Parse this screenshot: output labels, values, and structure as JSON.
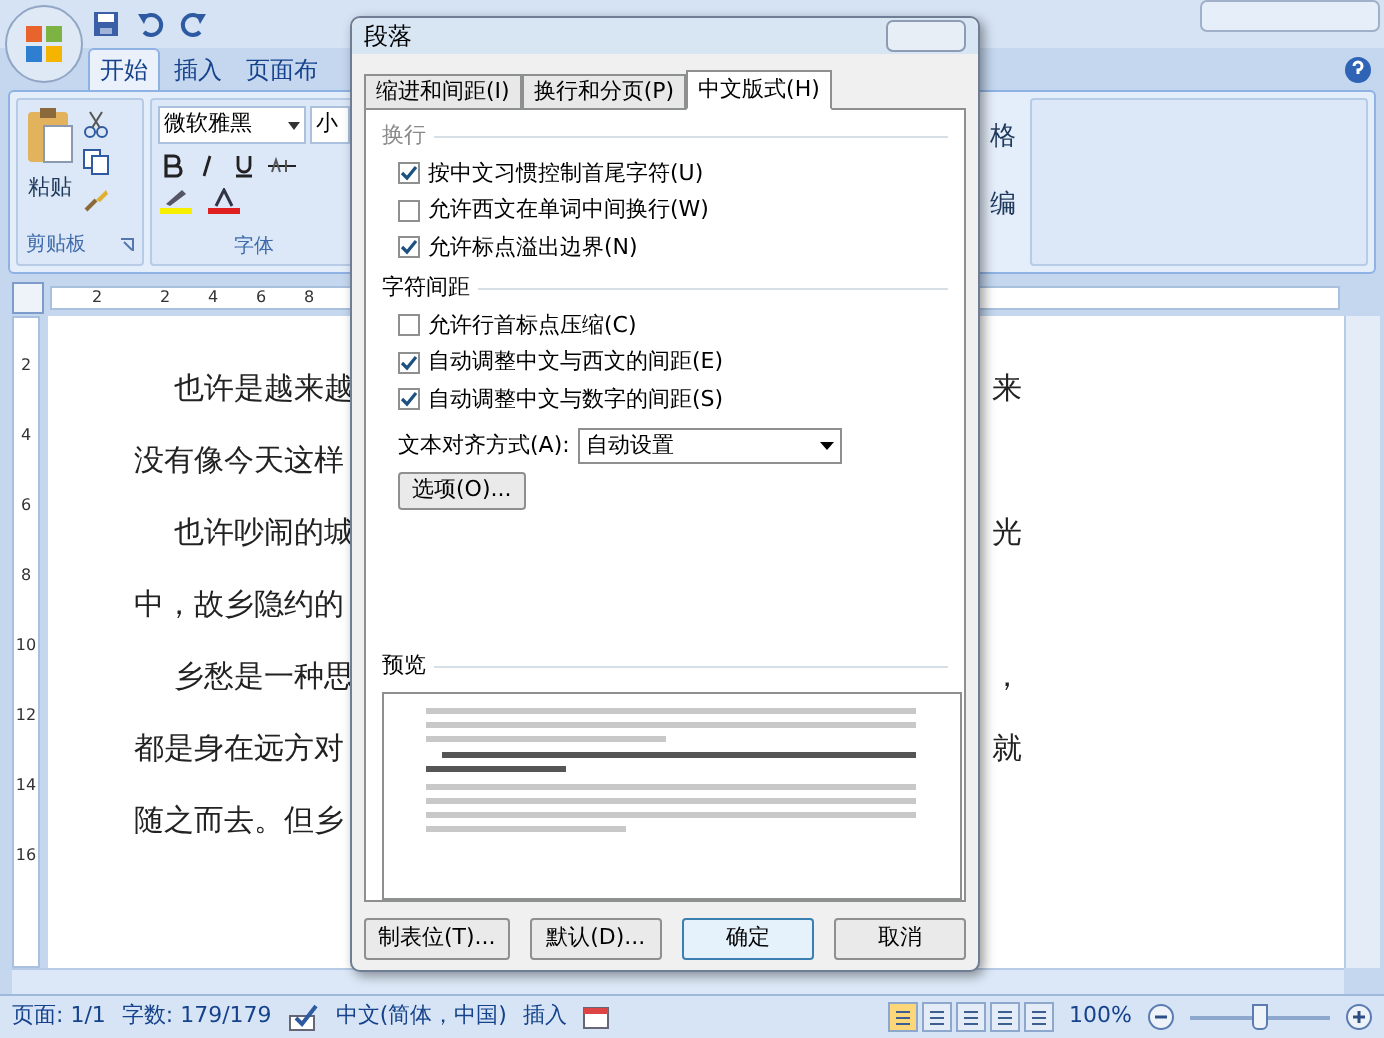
{
  "ribbon": {
    "tabs": [
      {
        "label": "开始",
        "selected": true
      },
      {
        "label": "插入",
        "selected": false
      },
      {
        "label": "页面布",
        "selected": false
      }
    ],
    "clipboard": {
      "paste": "粘贴",
      "group_label": "剪贴板"
    },
    "font": {
      "name": "微软雅黑",
      "size": "小",
      "group_label": "字体"
    },
    "fragments": [
      "格",
      "编"
    ]
  },
  "ruler": {
    "horizontal": [
      "2",
      "2",
      "4",
      "6",
      "8"
    ],
    "vertical": [
      "2",
      "4",
      "6",
      "8",
      "10",
      "12",
      "14",
      "16"
    ]
  },
  "document": {
    "lines": [
      {
        "text": "也许是越来越",
        "indent": true,
        "tail": "来"
      },
      {
        "text": "没有像今天这样",
        "indent": false
      },
      {
        "text": "也许吵闹的城",
        "indent": true,
        "tail": "光"
      },
      {
        "text": "中，故乡隐约的",
        "indent": false
      },
      {
        "text": "乡愁是一种思",
        "indent": true,
        "tail": "，"
      },
      {
        "text": "都是身在远方对",
        "indent": false,
        "tail": "就"
      },
      {
        "text": "随之而去。但乡",
        "indent": false
      }
    ]
  },
  "dialog": {
    "title": "段落",
    "tabs": [
      {
        "label": "缩进和间距(I)",
        "selected": false
      },
      {
        "label": "换行和分页(P)",
        "selected": false
      },
      {
        "label": "中文版式(H)",
        "selected": true
      }
    ],
    "sections": [
      {
        "title": "换行",
        "options": [
          {
            "label": "按中文习惯控制首尾字符(U)",
            "checked": true
          },
          {
            "label": "允许西文在单词中间换行(W)",
            "checked": false
          },
          {
            "label": "允许标点溢出边界(N)",
            "checked": true
          }
        ]
      },
      {
        "title": "字符间距",
        "options": [
          {
            "label": "允许行首标点压缩(C)",
            "checked": false
          },
          {
            "label": "自动调整中文与西文的间距(E)",
            "checked": true
          },
          {
            "label": "自动调整中文与数字的间距(S)",
            "checked": true
          }
        ]
      }
    ],
    "alignment": {
      "label": "文本对齐方式(A):",
      "value": "自动设置"
    },
    "options_button": "选项(O)...",
    "preview": {
      "title": "预览"
    },
    "buttons": [
      {
        "label": "制表位(T)...",
        "default": false
      },
      {
        "label": "默认(D)...",
        "default": false
      },
      {
        "label": "确定",
        "default": true
      },
      {
        "label": "取消",
        "default": false
      }
    ]
  },
  "status_bar": {
    "page": "页面: 1/1",
    "words": "字数: 179/179",
    "language": "中文(简体，中国)",
    "mode": "插入",
    "zoom": "100%",
    "zoom_slider": {
      "level": 0.5
    }
  }
}
